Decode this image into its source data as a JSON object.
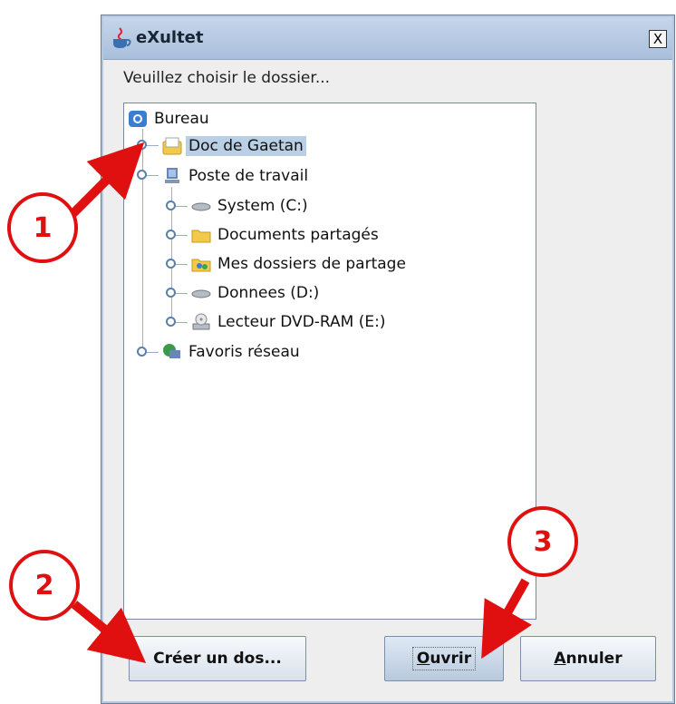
{
  "window": {
    "title": "eXultet",
    "close_label": "X",
    "prompt": "Veuillez choisir le dossier..."
  },
  "tree": {
    "items": [
      {
        "label": "Bureau",
        "icon": "desktop-icon",
        "level": 0
      },
      {
        "label": "Doc de Gaetan",
        "icon": "user-folder-icon",
        "level": 1,
        "selected": true
      },
      {
        "label": "Poste de travail",
        "icon": "computer-icon",
        "level": 1
      },
      {
        "label": "System (C:)",
        "icon": "drive-icon",
        "level": 2
      },
      {
        "label": "Documents partagés",
        "icon": "folder-icon",
        "level": 2
      },
      {
        "label": "Mes dossiers de partage",
        "icon": "shared-folder-icon",
        "level": 2
      },
      {
        "label": "Donnees (D:)",
        "icon": "drive-icon",
        "level": 2
      },
      {
        "label": "Lecteur DVD-RAM (E:)",
        "icon": "dvd-drive-icon",
        "level": 2
      },
      {
        "label": "Favoris réseau",
        "icon": "network-icon",
        "level": 1
      }
    ]
  },
  "buttons": {
    "create_folder": "Créer un dos...",
    "open": "Ouvrir",
    "cancel": "Annuler"
  },
  "annotations": {
    "callout_1": "1",
    "callout_2": "2",
    "callout_3": "3",
    "color": "#e01010"
  },
  "colors": {
    "titlebar": "#a9bfdc",
    "selection": "#b8cfe5",
    "window_bg": "#eeeeee"
  }
}
